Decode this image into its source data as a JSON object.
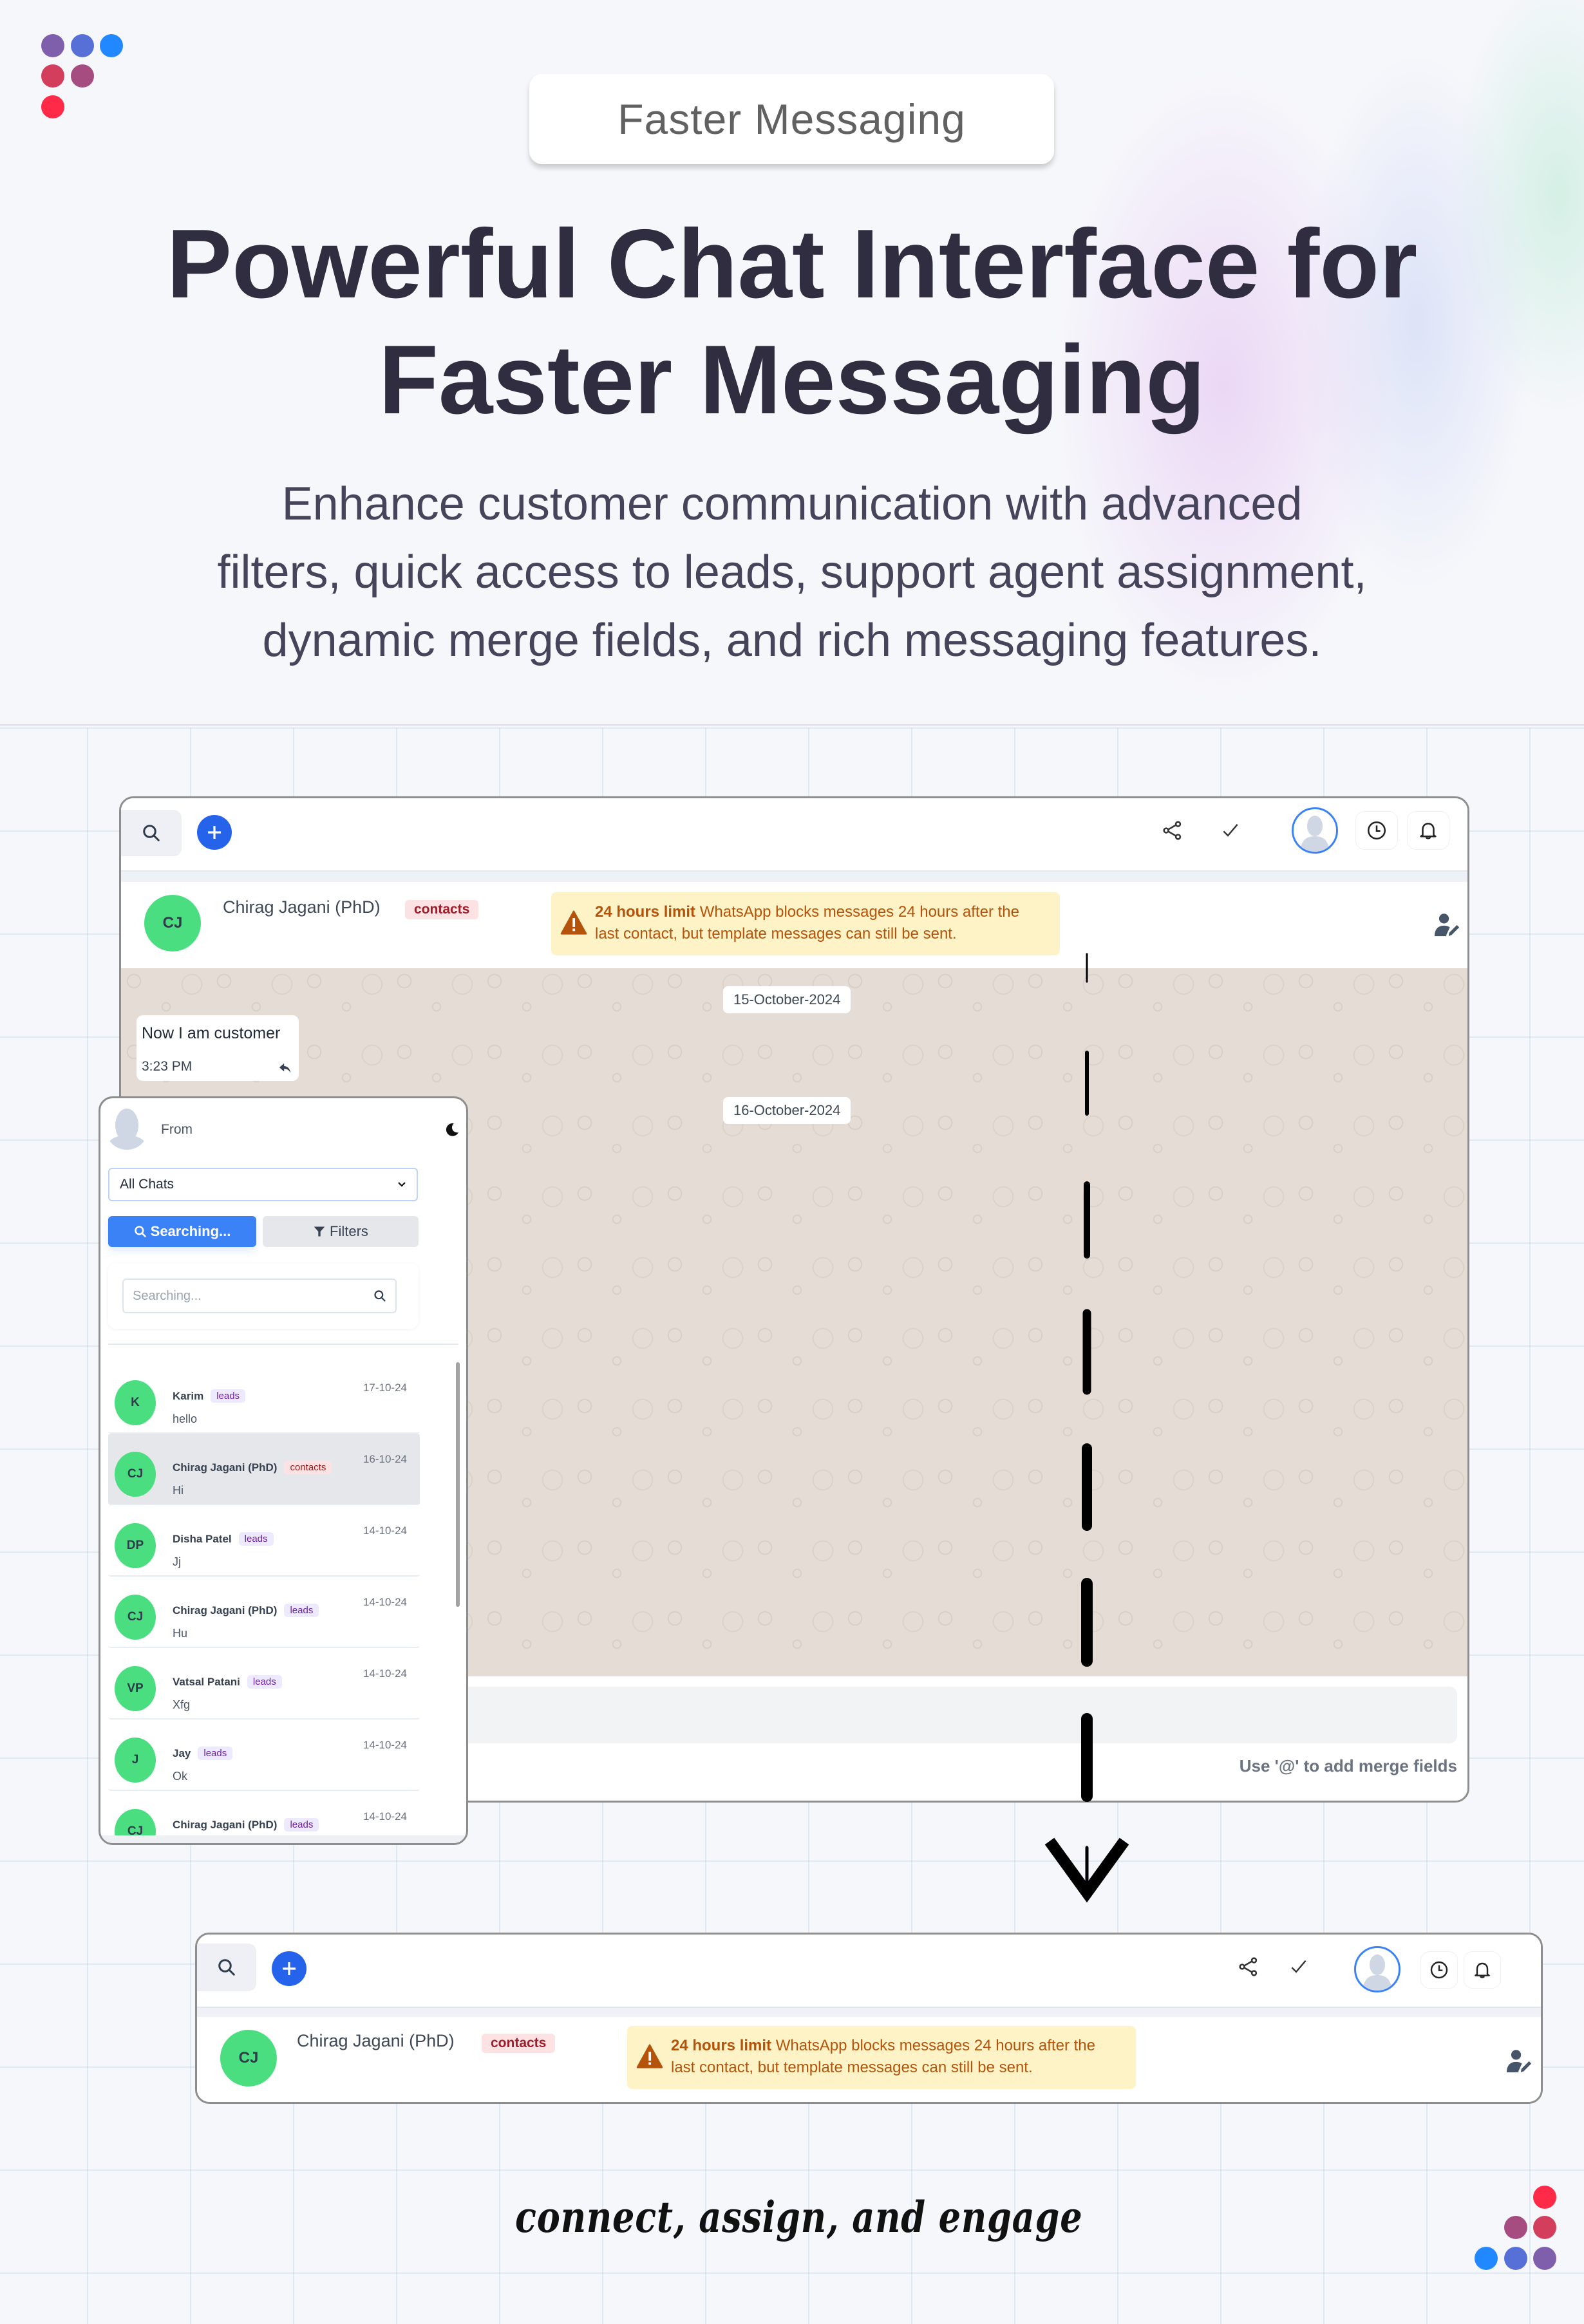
{
  "brand": {
    "logo_colors": [
      "#7f5fab",
      "#5670d8",
      "#2288ff",
      "#d23e5c",
      "#a64c80",
      "#ff2a48"
    ]
  },
  "header": {
    "pill_label": "Faster Messaging",
    "headline_line1": "Powerful Chat Interface for",
    "headline_line2": "Faster Messaging",
    "subtitle_line1": "Enhance customer communication with advanced",
    "subtitle_line2": "filters, quick access to leads, support agent assignment,",
    "subtitle_line3": "dynamic merge fields, and rich messaging features."
  },
  "main_window": {
    "toolbar": {
      "search_icon": "search-icon",
      "add_icon": "plus-icon",
      "share_icon": "share-icon",
      "check_icon": "check-icon",
      "avatar_icon": "user-avatar-icon",
      "clock_icon": "clock-icon",
      "bell_icon": "bell-icon"
    },
    "contact": {
      "initials": "CJ",
      "name": "Chirag Jagani (PhD)",
      "tag": "contacts"
    },
    "warning": {
      "title": "24 hours limit",
      "text": "WhatsApp blocks messages 24 hours after the last contact, but template messages can still be sent."
    },
    "dates": [
      "15-October-2024",
      "16-October-2024"
    ],
    "message": {
      "text": "Now I am customer",
      "time": "3:23 PM"
    },
    "composer_hint": "Use '@' to add merge fields"
  },
  "sidebar_panel": {
    "from_label": "From",
    "filter_select": "All Chats",
    "search_tab_label": "Searching...",
    "filters_tab_label": "Filters",
    "search_placeholder": "Searching...",
    "chats": [
      {
        "initials": "K",
        "name": "Karim",
        "tag": "leads",
        "message": "hello",
        "date": "17-10-24",
        "active": false
      },
      {
        "initials": "CJ",
        "name": "Chirag Jagani (PhD)",
        "tag": "contacts",
        "message": "Hi",
        "date": "16-10-24",
        "active": true
      },
      {
        "initials": "DP",
        "name": "Disha Patel",
        "tag": "leads",
        "message": "Jj",
        "date": "14-10-24",
        "active": false
      },
      {
        "initials": "CJ",
        "name": "Chirag Jagani (PhD)",
        "tag": "leads",
        "message": "Hu",
        "date": "14-10-24",
        "active": false
      },
      {
        "initials": "VP",
        "name": "Vatsal Patani",
        "tag": "leads",
        "message": "Xfg",
        "date": "14-10-24",
        "active": false
      },
      {
        "initials": "J",
        "name": "Jay",
        "tag": "leads",
        "message": "Ok",
        "date": "14-10-24",
        "active": false
      },
      {
        "initials": "CJ",
        "name": "Chirag Jagani (PhD)",
        "tag": "leads",
        "message": "",
        "date": "14-10-24",
        "active": false
      }
    ]
  },
  "second_window": {
    "contact": {
      "initials": "CJ",
      "name": "Chirag Jagani (PhD)",
      "tag": "contacts"
    },
    "warning": {
      "title": "24 hours limit",
      "text": "WhatsApp blocks messages 24 hours after the last contact, but template messages can still be sent."
    }
  },
  "tagline": "connect, assign, and engage",
  "colors": {
    "accent_blue": "#2563eb",
    "avatar_green": "#4ade80",
    "warning_bg": "#fef3c7",
    "warning_text": "#b45309",
    "chat_bg": "#e5ddd5"
  }
}
